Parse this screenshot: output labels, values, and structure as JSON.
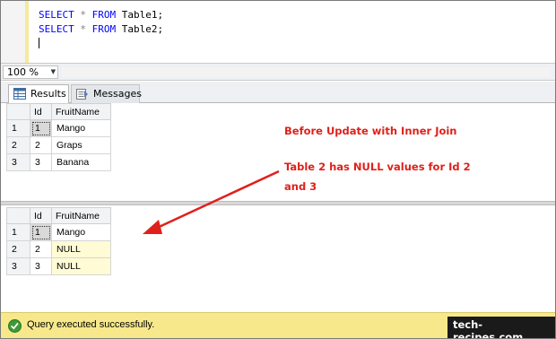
{
  "editor": {
    "lines": [
      {
        "kw1": "SELECT",
        "op": "*",
        "kw2": "FROM",
        "table": "Table1;"
      },
      {
        "kw1": "SELECT",
        "op": "*",
        "kw2": "FROM",
        "table": "Table2;"
      }
    ]
  },
  "zoom": {
    "value": "100 %"
  },
  "tabs": {
    "results": "Results",
    "messages": "Messages"
  },
  "grid1": {
    "columns": [
      "Id",
      "FruitName"
    ],
    "rows": [
      {
        "num": "1",
        "id": "1",
        "name": "Mango"
      },
      {
        "num": "2",
        "id": "2",
        "name": "Graps"
      },
      {
        "num": "3",
        "id": "3",
        "name": "Banana"
      }
    ]
  },
  "grid2": {
    "columns": [
      "Id",
      "FruitName"
    ],
    "rows": [
      {
        "num": "1",
        "id": "1",
        "name": "Mango"
      },
      {
        "num": "2",
        "id": "2",
        "name": "NULL"
      },
      {
        "num": "3",
        "id": "3",
        "name": "NULL"
      }
    ]
  },
  "annotations": {
    "title": "Before Update with Inner Join",
    "line1": "Table 2 has NULL values for Id 2",
    "line2": "and 3",
    "color": "#e0201a"
  },
  "status": {
    "text": "Query executed successfully.",
    "watermark": "tech-recipes.com"
  }
}
